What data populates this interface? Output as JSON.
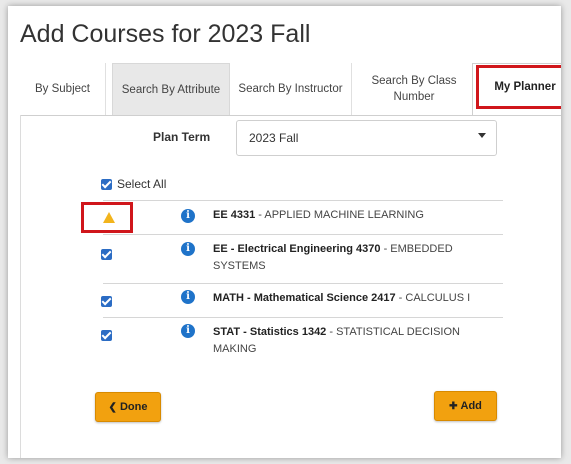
{
  "page": {
    "title": "Add Courses for 2023 Fall"
  },
  "tabs": [
    {
      "label": "By Subject"
    },
    {
      "label": "Search By Attribute"
    },
    {
      "label": "Search By Instructor"
    },
    {
      "label": "Search By Class Number"
    },
    {
      "label": "My Planner"
    }
  ],
  "plan_term": {
    "label": "Plan Term",
    "value": "2023 Fall"
  },
  "select_all": {
    "label": "Select All"
  },
  "courses": [
    {
      "code": "EE 4331",
      "title": " - APPLIED MACHINE LEARNING",
      "status_icon": "warning-icon"
    },
    {
      "code": "EE - Electrical Engineering 4370",
      "title": " - EMBEDDED SYSTEMS",
      "status_icon": "checkbox"
    },
    {
      "code": "MATH - Mathematical Science 2417",
      "title": " - CALCULUS I",
      "status_icon": "checkbox"
    },
    {
      "code": "STAT - Statistics 1342",
      "title": " - STATISTICAL DECISION MAKING",
      "status_icon": "checkbox"
    }
  ],
  "buttons": {
    "done": "Done",
    "add": "Add"
  },
  "colors": {
    "accent_orange": "#f2a10f",
    "highlight_red": "#d0161b",
    "checkbox_blue": "#2b6cc4",
    "info_blue": "#1f73c9",
    "warning_yellow": "#f2b41c"
  }
}
